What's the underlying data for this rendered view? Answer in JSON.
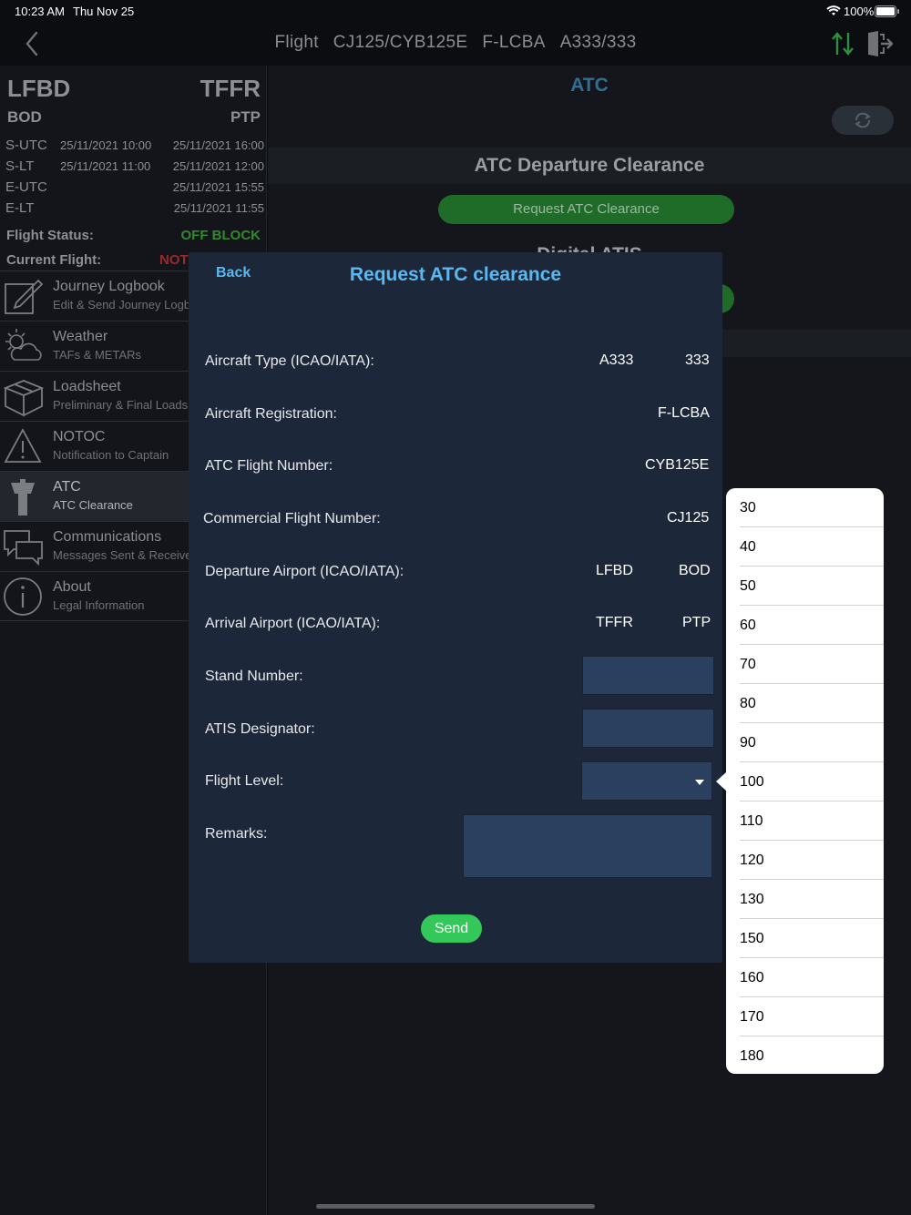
{
  "status": {
    "time": "10:23 AM",
    "date": "Thu Nov 25",
    "battery": "100%"
  },
  "header": {
    "label": "Flight",
    "flight": "CJ125/CYB125E",
    "registration": "F-LCBA",
    "aircraft": "A333/333"
  },
  "flight": {
    "from_icao": "LFBD",
    "to_icao": "TFFR",
    "from_iata": "BOD",
    "to_iata": "PTP",
    "times": [
      {
        "label": "S-UTC",
        "dep": "25/11/2021 10:00",
        "arr": "25/11/2021 16:00"
      },
      {
        "label": "S-LT",
        "dep": "25/11/2021 11:00",
        "arr": "25/11/2021 12:00"
      },
      {
        "label": "E-UTC",
        "dep": "",
        "arr": "25/11/2021 15:55"
      },
      {
        "label": "E-LT",
        "dep": "",
        "arr": "25/11/2021 11:55"
      }
    ],
    "status_label": "Flight Status:",
    "status_value": "OFF BLOCK",
    "current_label": "Current Flight:",
    "current_value": "NOT"
  },
  "menu": [
    {
      "title": "Journey Logbook",
      "subtitle": "Edit & Send Journey Logbook",
      "icon": "edit-icon"
    },
    {
      "title": "Weather",
      "subtitle": "TAFs & METARs",
      "icon": "weather-icon"
    },
    {
      "title": "Loadsheet",
      "subtitle": "Preliminary & Final Loadsheet",
      "icon": "box-icon"
    },
    {
      "title": "NOTOC",
      "subtitle": "Notification to Captain",
      "icon": "warning-icon"
    },
    {
      "title": "ATC",
      "subtitle": "ATC Clearance",
      "icon": "tower-icon"
    },
    {
      "title": "Communications",
      "subtitle": "Messages Sent & Received",
      "icon": "chat-icon"
    },
    {
      "title": "About",
      "subtitle": "Legal Information",
      "icon": "info-icon"
    }
  ],
  "atc": {
    "title": "ATC",
    "departure_section": "ATC Departure Clearance",
    "request_button": "Request ATC Clearance",
    "datis_section": "Digital ATIS"
  },
  "modal": {
    "back": "Back",
    "title": "Request ATC clearance",
    "fields": {
      "aircraft_type": {
        "label": "Aircraft Type (ICAO/IATA):",
        "icao": "A333",
        "iata": "333"
      },
      "registration": {
        "label": "Aircraft Registration:",
        "value": "F-LCBA"
      },
      "atc_flight": {
        "label": "ATC Flight Number:",
        "value": "CYB125E"
      },
      "commercial_flight": {
        "label": "Commercial Flight Number:",
        "value": "CJ125"
      },
      "departure": {
        "label": "Departure Airport (ICAO/IATA):",
        "icao": "LFBD",
        "iata": "BOD"
      },
      "arrival": {
        "label": "Arrival Airport (ICAO/IATA):",
        "icao": "TFFR",
        "iata": "PTP"
      },
      "stand": {
        "label": "Stand Number:",
        "value": ""
      },
      "atis": {
        "label": "ATIS Designator:",
        "value": ""
      },
      "flight_level": {
        "label": "Flight Level:",
        "value": ""
      },
      "remarks": {
        "label": "Remarks:",
        "value": ""
      }
    },
    "send": "Send"
  },
  "flight_level_options": [
    "30",
    "40",
    "50",
    "60",
    "70",
    "80",
    "90",
    "100",
    "110",
    "120",
    "130",
    "150",
    "160",
    "170",
    "180"
  ]
}
